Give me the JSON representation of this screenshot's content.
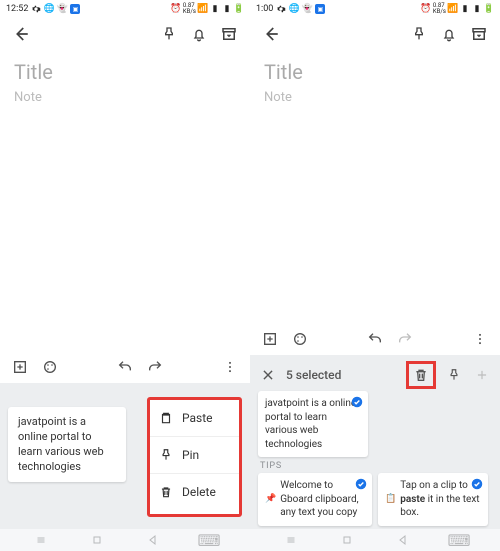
{
  "status": {
    "left": {
      "time": "12:52"
    },
    "right": {
      "time": "1:00"
    }
  },
  "app": {
    "title_placeholder": "Title",
    "note_placeholder": "Note"
  },
  "clipboard": {
    "clip1_text": "javatpoint is a online portal to learn various web technologies",
    "context": {
      "paste": "Paste",
      "pin": "Pin",
      "delete": "Delete"
    }
  },
  "selection": {
    "count_label": "5 selected"
  },
  "tips": {
    "label": "TIPS",
    "tip1_prefix": "Welcome to Gboard clipboard, any text you copy",
    "tip2_a": "Tap on a clip to",
    "tip2_bold": "paste",
    "tip2_b": " it in the text box."
  }
}
